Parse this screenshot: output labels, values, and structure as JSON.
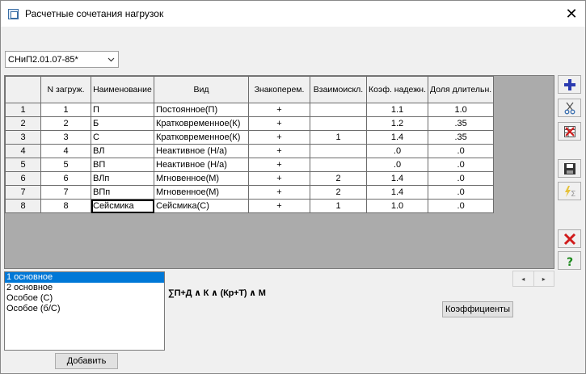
{
  "window": {
    "title": "Расчетные сочетания нагрузок",
    "close_label": "✕"
  },
  "norm_select": {
    "value": "СНиП2.01.07-85*"
  },
  "grid": {
    "headers": [
      "",
      "N загруж.",
      "Наименование",
      "Вид",
      "Знакоперем.",
      "Взаимоискл.",
      "Коэф. надежн.",
      "Доля длительн."
    ],
    "rows": [
      [
        "1",
        "1",
        "П",
        "Постоянное(П)",
        "+",
        "",
        "1.1",
        "1.0"
      ],
      [
        "2",
        "2",
        "Б",
        "Кратковременное(К)",
        "+",
        "",
        "1.2",
        ".35"
      ],
      [
        "3",
        "3",
        "С",
        "Кратковременное(К)",
        "+",
        "1",
        "1.4",
        ".35"
      ],
      [
        "4",
        "4",
        "ВЛ",
        "Неактивное (Н/а)",
        "+",
        "",
        ".0",
        ".0"
      ],
      [
        "5",
        "5",
        "ВП",
        "Неактивное (Н/а)",
        "+",
        "",
        ".0",
        ".0"
      ],
      [
        "6",
        "6",
        "ВЛп",
        "Мгновенное(М)",
        "+",
        "2",
        "1.4",
        ".0"
      ],
      [
        "7",
        "7",
        "ВПп",
        "Мгновенное(М)",
        "+",
        "2",
        "1.4",
        ".0"
      ],
      [
        "8",
        "8",
        "Сейсмика",
        "Сейсмика(С)",
        "+",
        "1",
        "1.0",
        ".0"
      ]
    ]
  },
  "toolbar": {
    "add": "plus-icon",
    "cut": "scissors-icon",
    "delete_table": "delete-table-icon",
    "save": "floppy-disk-icon",
    "sum": "lightning-sum-icon",
    "remove": "red-cross-icon",
    "help": "question-icon",
    "colors": {
      "add": "#2b3bb0",
      "remove": "#d11b1b",
      "help": "#1c8a1c"
    }
  },
  "combinations": {
    "items": [
      "1 основное",
      "2 основное",
      "Особое (С)",
      "Особое (б/С)"
    ],
    "selected_index": 0
  },
  "formula": "∑П+Д ∧ К ∧ (Кр+Т) ∧ М",
  "buttons": {
    "coefficients": "Коэффициенты",
    "add": "Добавить"
  },
  "pager": {
    "prev": "◂",
    "next": "▸"
  }
}
